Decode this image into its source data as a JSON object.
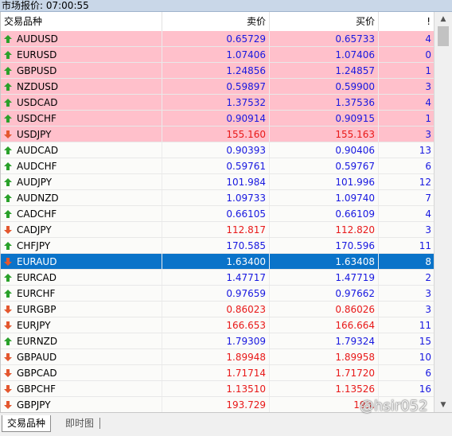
{
  "window": {
    "title": "市场报价: 07:00:55"
  },
  "header": {
    "symbol": "交易品种",
    "bid": "卖价",
    "ask": "买价",
    "spread": "!"
  },
  "colors": {
    "pink_row": "#ffc0cb",
    "selected_row": "#0a73c9",
    "blue_price": "#1717e0",
    "red_price": "#e81818",
    "up_arrow": "#2aa12a",
    "down_arrow": "#e4572e"
  },
  "rows": [
    {
      "symbol": "AUDUSD",
      "bid": "0.65729",
      "ask": "0.65733",
      "spread": "4",
      "dir": "up",
      "price_color": "blue",
      "bg": "pink"
    },
    {
      "symbol": "EURUSD",
      "bid": "1.07406",
      "ask": "1.07406",
      "spread": "0",
      "dir": "up",
      "price_color": "blue",
      "bg": "pink"
    },
    {
      "symbol": "GBPUSD",
      "bid": "1.24856",
      "ask": "1.24857",
      "spread": "1",
      "dir": "up",
      "price_color": "blue",
      "bg": "pink"
    },
    {
      "symbol": "NZDUSD",
      "bid": "0.59897",
      "ask": "0.59900",
      "spread": "3",
      "dir": "up",
      "price_color": "blue",
      "bg": "pink"
    },
    {
      "symbol": "USDCAD",
      "bid": "1.37532",
      "ask": "1.37536",
      "spread": "4",
      "dir": "up",
      "price_color": "blue",
      "bg": "pink"
    },
    {
      "symbol": "USDCHF",
      "bid": "0.90914",
      "ask": "0.90915",
      "spread": "1",
      "dir": "up",
      "price_color": "blue",
      "bg": "pink"
    },
    {
      "symbol": "USDJPY",
      "bid": "155.160",
      "ask": "155.163",
      "spread": "3",
      "dir": "down",
      "price_color": "red",
      "bg": "pink"
    },
    {
      "symbol": "AUDCAD",
      "bid": "0.90393",
      "ask": "0.90406",
      "spread": "13",
      "dir": "up",
      "price_color": "blue",
      "bg": "white"
    },
    {
      "symbol": "AUDCHF",
      "bid": "0.59761",
      "ask": "0.59767",
      "spread": "6",
      "dir": "up",
      "price_color": "blue",
      "bg": "white"
    },
    {
      "symbol": "AUDJPY",
      "bid": "101.984",
      "ask": "101.996",
      "spread": "12",
      "dir": "up",
      "price_color": "blue",
      "bg": "white"
    },
    {
      "symbol": "AUDNZD",
      "bid": "1.09733",
      "ask": "1.09740",
      "spread": "7",
      "dir": "up",
      "price_color": "blue",
      "bg": "white"
    },
    {
      "symbol": "CADCHF",
      "bid": "0.66105",
      "ask": "0.66109",
      "spread": "4",
      "dir": "up",
      "price_color": "blue",
      "bg": "white"
    },
    {
      "symbol": "CADJPY",
      "bid": "112.817",
      "ask": "112.820",
      "spread": "3",
      "dir": "down",
      "price_color": "red",
      "bg": "white"
    },
    {
      "symbol": "CHFJPY",
      "bid": "170.585",
      "ask": "170.596",
      "spread": "11",
      "dir": "up",
      "price_color": "blue",
      "bg": "white"
    },
    {
      "symbol": "EURAUD",
      "bid": "1.63400",
      "ask": "1.63408",
      "spread": "8",
      "dir": "down",
      "price_color": "white",
      "bg": "selected"
    },
    {
      "symbol": "EURCAD",
      "bid": "1.47717",
      "ask": "1.47719",
      "spread": "2",
      "dir": "up",
      "price_color": "blue",
      "bg": "white"
    },
    {
      "symbol": "EURCHF",
      "bid": "0.97659",
      "ask": "0.97662",
      "spread": "3",
      "dir": "up",
      "price_color": "blue",
      "bg": "white"
    },
    {
      "symbol": "EURGBP",
      "bid": "0.86023",
      "ask": "0.86026",
      "spread": "3",
      "dir": "down",
      "price_color": "red",
      "bg": "white"
    },
    {
      "symbol": "EURJPY",
      "bid": "166.653",
      "ask": "166.664",
      "spread": "11",
      "dir": "down",
      "price_color": "red",
      "bg": "white"
    },
    {
      "symbol": "EURNZD",
      "bid": "1.79309",
      "ask": "1.79324",
      "spread": "15",
      "dir": "up",
      "price_color": "blue",
      "bg": "white"
    },
    {
      "symbol": "GBPAUD",
      "bid": "1.89948",
      "ask": "1.89958",
      "spread": "10",
      "dir": "down",
      "price_color": "red",
      "bg": "white"
    },
    {
      "symbol": "GBPCAD",
      "bid": "1.71714",
      "ask": "1.71720",
      "spread": "6",
      "dir": "down",
      "price_color": "red",
      "bg": "white"
    },
    {
      "symbol": "GBPCHF",
      "bid": "1.13510",
      "ask": "1.13526",
      "spread": "16",
      "dir": "down",
      "price_color": "red",
      "bg": "white"
    },
    {
      "symbol": "GBPJPY",
      "bid": "193.729",
      "ask": "193.",
      "spread": "",
      "dir": "down",
      "price_color": "red",
      "bg": "white"
    }
  ],
  "tabs": [
    {
      "label": "交易品种",
      "active": true
    },
    {
      "label": "即时图",
      "active": false
    }
  ],
  "watermark": "@hsir052"
}
